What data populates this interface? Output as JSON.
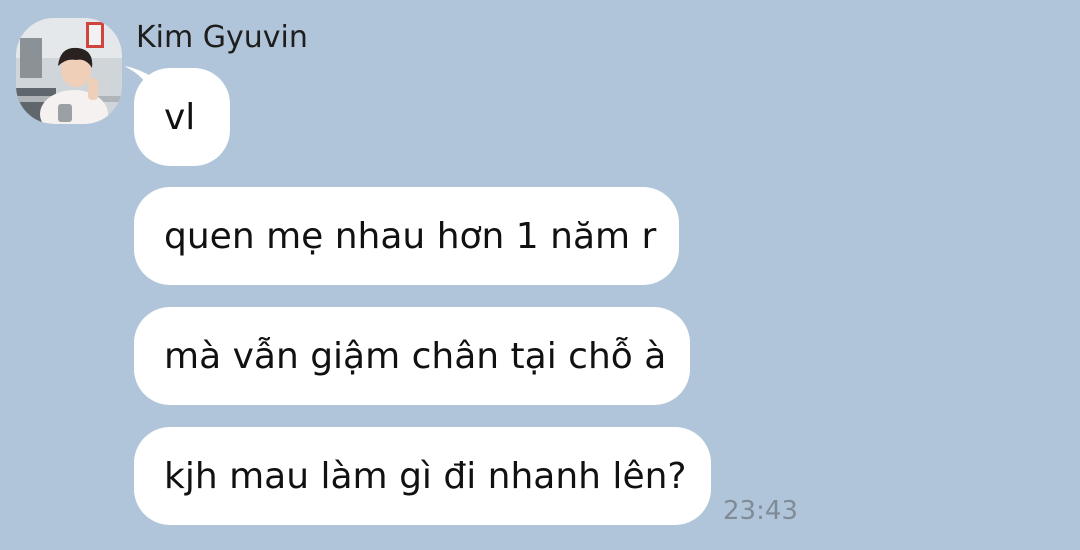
{
  "sender": {
    "name": "Kim Gyuvin",
    "avatar_icon": "profile-photo"
  },
  "messages": [
    {
      "text": "vl"
    },
    {
      "text": "quen mẹ nhau hơn 1 năm r"
    },
    {
      "text": "mà vẫn giậm chân tại chỗ à"
    },
    {
      "text": "kjh mau làm gì đi nhanh lên?"
    }
  ],
  "timestamp": "23:43",
  "colors": {
    "background": "#b1c5da",
    "bubble": "#ffffff",
    "timestamp": "#7f8c98"
  }
}
